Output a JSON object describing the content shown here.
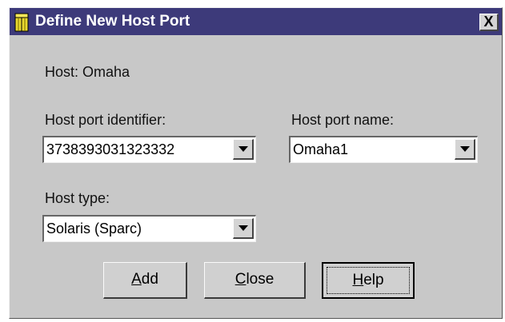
{
  "window": {
    "title": "Define New Host Port",
    "icon": "host-port-icon",
    "close_label": "X"
  },
  "host": {
    "label": "Host: Omaha"
  },
  "host_port_identifier": {
    "label": "Host port identifier:",
    "value": "3738393031323332"
  },
  "host_port_name": {
    "label": "Host port name:",
    "value": "Omaha1"
  },
  "host_type": {
    "label": "Host type:",
    "value": "Solaris (Sparc)"
  },
  "buttons": {
    "add": {
      "mnemonic": "A",
      "rest": "dd"
    },
    "close": {
      "mnemonic": "C",
      "rest": "lose"
    },
    "help": {
      "mnemonic": "H",
      "rest": "elp"
    }
  },
  "colors": {
    "titlebar": "#3d3a7a",
    "dialog_bg": "#c8c8c8",
    "field_bg": "#ffffff"
  }
}
